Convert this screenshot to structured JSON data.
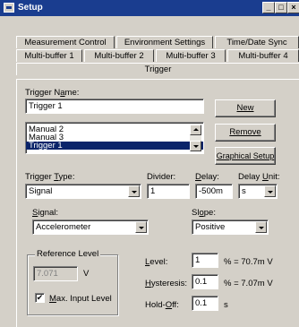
{
  "window": {
    "title": "Setup",
    "min_label": "_",
    "max_label": "□",
    "close_label": "×"
  },
  "tabs_back": [
    "Measurement Control",
    "Environment Settings",
    "Time/Date Sync"
  ],
  "tabs_mid": [
    "Multi-buffer 1",
    "Multi-buffer 2",
    "Multi-buffer 3",
    "Multi-buffer 4"
  ],
  "tab_active": "Trigger",
  "trigger_name": {
    "label": "Trigger Name:",
    "value": "Trigger 1"
  },
  "trigger_list": {
    "items": [
      "Manual 2",
      "Manual 3",
      "Trigger 1"
    ],
    "selected_index": 2
  },
  "buttons": {
    "new": "New",
    "remove": "Remove",
    "graphical_setup": "Graphical Setup"
  },
  "trigger_type": {
    "label": "Trigger Type:",
    "value": "Signal"
  },
  "divider": {
    "label": "Divider:",
    "value": "1"
  },
  "delay": {
    "label": "Delay:",
    "value": "-500m"
  },
  "delay_unit": {
    "label": "Delay Unit:",
    "value": "s"
  },
  "signal": {
    "label": "Signal:",
    "value": "Accelerometer"
  },
  "slope": {
    "label": "Slope:",
    "value": "Positive"
  },
  "reference_level": {
    "label": "Reference Level",
    "value": "7.071",
    "unit": "V",
    "max_input_label": "Max. Input Level",
    "max_input_checked": "✔"
  },
  "level": {
    "label": "Level:",
    "value": "1",
    "note": "% = 70.7m V"
  },
  "hysteresis": {
    "label": "Hysteresis:",
    "value": "0.1",
    "note": "% = 7.07m V"
  },
  "hold_off": {
    "label": "Hold-Off:",
    "value": "0.1",
    "note": "s"
  }
}
